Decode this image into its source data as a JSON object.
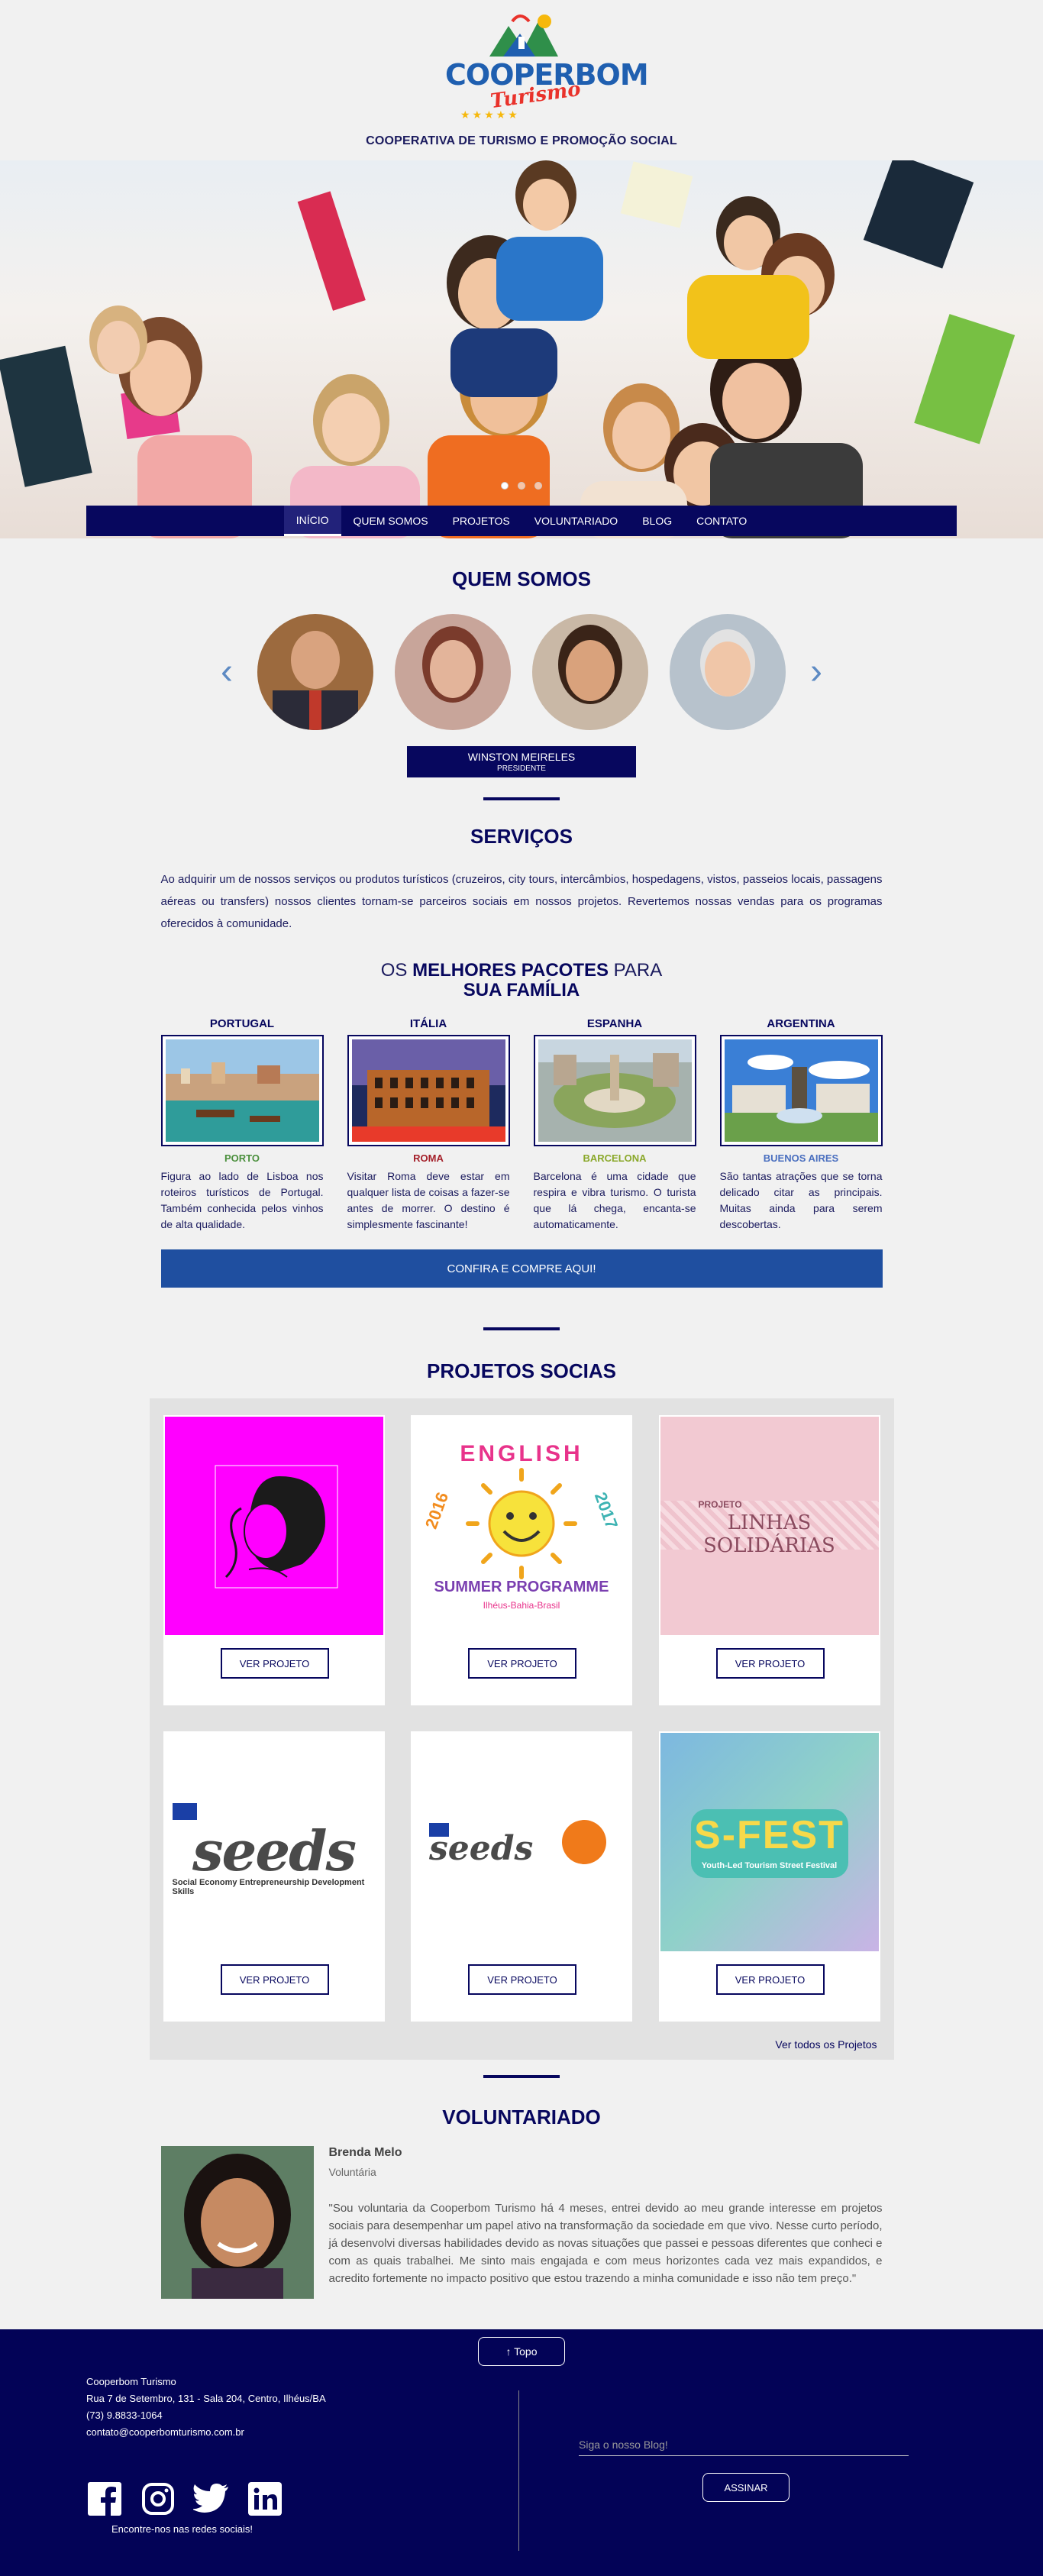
{
  "brand": {
    "logo_main": "COOPERBOM",
    "logo_sub": "Turismo",
    "logo_stars": "★★★★★",
    "tagline": "COOPERATIVA DE TURISMO E PROMOÇÃO SOCIAL"
  },
  "nav": {
    "items": [
      "INÍCIO",
      "QUEM SOMOS",
      "PROJETOS",
      "VOLUNTARIADO",
      "BLOG",
      "CONTATO"
    ],
    "active": "INÍCIO"
  },
  "about": {
    "title": "QUEM SOMOS",
    "member_name": "WINSTON MEIRELES",
    "member_role": "PRESIDENTE",
    "prev_arrow": "‹",
    "next_arrow": "›"
  },
  "services": {
    "title": "SERVIÇOS",
    "text": "Ao adquirir um de nossos serviços ou produtos turísticos (cruzeiros, city tours, intercâmbios, hospedagens, vistos, passeios locais, passagens aéreas ou transfers) nossos clientes tornam-se parceiros sociais em nossos projetos. Revertemos nossas vendas para os programas oferecidos à comunidade.",
    "packages_title_pre": "OS ",
    "packages_title_bold": "MELHORES PACOTES",
    "packages_title_post": " PARA",
    "packages_title_line2": "SUA FAMÍLIA",
    "packages": [
      {
        "country": "PORTUGAL",
        "city": "PORTO",
        "city_color": "#4a8f3c",
        "desc": "Figura ao lado de Lisboa nos roteiros turísticos de Portugal. Também conhecida pelos vinhos de alta qualidade."
      },
      {
        "country": "ITÁLIA",
        "city": "ROMA",
        "city_color": "#a4202a",
        "desc": "Visitar Roma deve estar em qualquer lista de coisas a fazer-se antes de morrer. O destino é simplesmente fascinante!"
      },
      {
        "country": "ESPANHA",
        "city": "BARCELONA",
        "city_color": "#8aa82a",
        "desc": "Barcelona é uma cidade que respira e vibra turismo. O turista que lá chega, encanta-se automaticamente."
      },
      {
        "country": "ARGENTINA",
        "city": "BUENOS AIRES",
        "city_color": "#4a6fbf",
        "desc": "São tantas atrações que se torna delicado citar as principais. Muitas ainda para serem descobertas."
      }
    ],
    "buy_label": "CONFIRA E COMPRE AQUI!"
  },
  "projects": {
    "title": "PROJETOS SOCIAS",
    "button_label": "VER PROJETO",
    "see_all": "Ver todos os Projetos",
    "items": [
      {
        "art": "face"
      },
      {
        "art_line1": "ENGLISH",
        "art_year_l": "2016",
        "art_year_r": "2017",
        "art_line2": "SUMMER PROGRAMME",
        "art_line3": "Ilhéus-Bahia-Brasil"
      },
      {
        "art_line1": "PROJETO",
        "art_line2": "LINHAS SOLIDÁRIAS"
      },
      {
        "art_line1": "seeds",
        "art_line2": "Social Economy Entrepreneurship Development Skills"
      },
      {
        "art_line1": "seeds"
      },
      {
        "art_line1": "S-FEST",
        "art_line2": "Youth-Led Tourism Street Festival"
      }
    ]
  },
  "volunteer": {
    "title": "VOLUNTARIADO",
    "name": "Brenda Melo",
    "role": "Voluntária",
    "quote": "\"Sou voluntaria da Cooperbom Turismo há 4 meses, entrei devido ao meu grande interesse em projetos sociais para desempenhar um papel ativo na transformação da sociedade em que vivo. Nesse curto período, já desenvolvi diversas habilidades devido as novas situações que passei e pessoas diferentes que conheci e com as quais trabalhei. Me sinto mais engajada e com meus horizontes cada vez mais expandidos, e acredito fortemente no impacto positivo que estou trazendo a minha comunidade e isso não tem preço.\""
  },
  "footer": {
    "top_label": "↑ Topo",
    "company": "Cooperbom Turismo",
    "address": "Rua 7 de Setembro, 131 - Sala 204, Centro, Ilhéus/BA",
    "phone": "(73) 9.8833-1064",
    "email": "contato@cooperbomturismo.com.br",
    "social_label": "Encontre-nos nas redes sociais!",
    "newsletter_placeholder": "Siga o nosso Blog!",
    "newsletter_button": "ASSINAR",
    "social": [
      "facebook-icon",
      "instagram-icon",
      "twitter-icon",
      "linkedin-icon"
    ],
    "bg_color": "#030357"
  }
}
